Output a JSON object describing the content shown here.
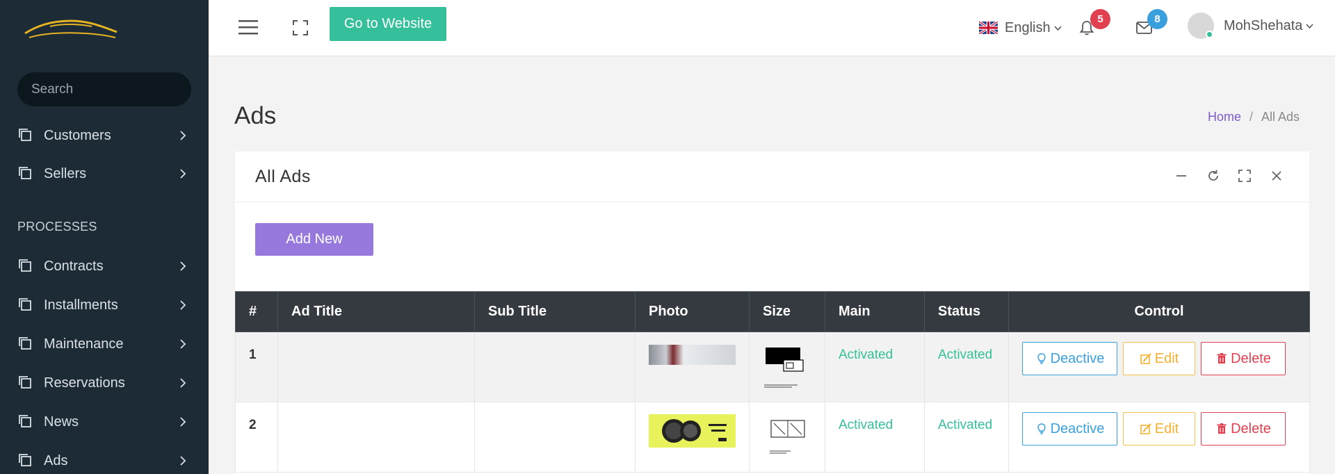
{
  "sidebar": {
    "search_placeholder": "Search",
    "section_label": "PROCESSES",
    "items": [
      {
        "label": "Customers"
      },
      {
        "label": "Sellers"
      },
      {
        "label": "Contracts"
      },
      {
        "label": "Installments"
      },
      {
        "label": "Maintenance"
      },
      {
        "label": "Reservations"
      },
      {
        "label": "News"
      },
      {
        "label": "Ads"
      }
    ]
  },
  "topbar": {
    "go_website_label": "Go to Website",
    "language": "English",
    "notifications_count": "5",
    "messages_count": "8",
    "username": "MohShehata"
  },
  "page": {
    "title": "Ads",
    "breadcrumb_home": "Home",
    "breadcrumb_sep": "/",
    "breadcrumb_current": "All Ads"
  },
  "card": {
    "title": "All Ads",
    "add_new_label": "Add New"
  },
  "table": {
    "headers": [
      "#",
      "Ad Title",
      "Sub Title",
      "Photo",
      "Size",
      "Main",
      "Status",
      "Control"
    ],
    "rows": [
      {
        "num": "1",
        "ad_title": "",
        "sub_title": "",
        "main": "Activated",
        "status": "Activated"
      },
      {
        "num": "2",
        "ad_title": "",
        "sub_title": "",
        "main": "Activated",
        "status": "Activated"
      }
    ],
    "actions": {
      "deactive": "Deactive",
      "edit": "Edit",
      "delete": "Delete"
    }
  },
  "colors": {
    "sidebar_bg": "#1d2b36",
    "accent_green": "#35bf9a",
    "accent_purple": "#9779dd",
    "header_dark": "#343a40",
    "info_blue": "#3aa0dd",
    "warning_yellow": "#f5b030",
    "danger_red": "#e04050"
  }
}
